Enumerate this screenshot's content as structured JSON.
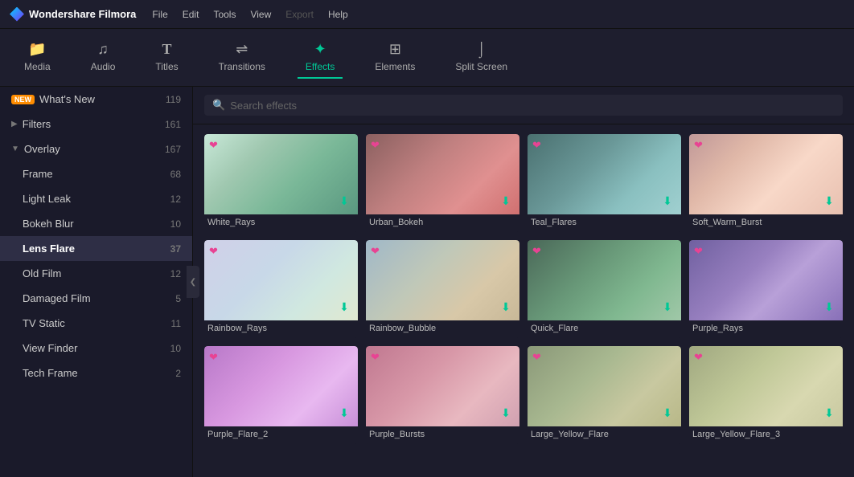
{
  "app": {
    "name": "Wondershare Filmora",
    "logo_alt": "Filmora logo"
  },
  "menu": {
    "items": [
      "File",
      "Edit",
      "Tools",
      "View",
      "Export",
      "Help"
    ],
    "disabled": [
      "Export"
    ]
  },
  "nav_tabs": [
    {
      "id": "media",
      "label": "Media",
      "icon": "🗂"
    },
    {
      "id": "audio",
      "label": "Audio",
      "icon": "🎵"
    },
    {
      "id": "titles",
      "label": "Titles",
      "icon": "T"
    },
    {
      "id": "transitions",
      "label": "Transitions",
      "icon": "↔"
    },
    {
      "id": "effects",
      "label": "Effects",
      "icon": "✦"
    },
    {
      "id": "elements",
      "label": "Elements",
      "icon": "⊞"
    },
    {
      "id": "split_screen",
      "label": "Split Screen",
      "icon": "⊡"
    }
  ],
  "active_tab": "effects",
  "sidebar": {
    "items": [
      {
        "id": "whats-new",
        "label": "What's New",
        "count": "119",
        "badge": "NEW",
        "expanded": false,
        "indent": 0
      },
      {
        "id": "filters",
        "label": "Filters",
        "count": "161",
        "arrow": "▶",
        "expanded": false,
        "indent": 0
      },
      {
        "id": "overlay",
        "label": "Overlay",
        "count": "167",
        "arrow": "▼",
        "expanded": true,
        "indent": 0
      },
      {
        "id": "frame",
        "label": "Frame",
        "count": "68",
        "indent": 1
      },
      {
        "id": "light-leak",
        "label": "Light Leak",
        "count": "12",
        "indent": 1
      },
      {
        "id": "bokeh-blur",
        "label": "Bokeh Blur",
        "count": "10",
        "indent": 1
      },
      {
        "id": "lens-flare",
        "label": "Lens Flare",
        "count": "37",
        "indent": 1,
        "active": true
      },
      {
        "id": "old-film",
        "label": "Old Film",
        "count": "12",
        "indent": 1
      },
      {
        "id": "damaged-film",
        "label": "Damaged Film",
        "count": "5",
        "indent": 1
      },
      {
        "id": "tv-static",
        "label": "TV Static",
        "count": "11",
        "indent": 1
      },
      {
        "id": "view-finder",
        "label": "View Finder",
        "count": "10",
        "indent": 1
      },
      {
        "id": "tech-frame",
        "label": "Tech Frame",
        "count": "2",
        "indent": 1
      }
    ]
  },
  "search": {
    "placeholder": "Search effects"
  },
  "effects_grid": {
    "items": [
      {
        "id": "white-rays",
        "name": "White_Rays",
        "thumb_class": "thumb-white-rays"
      },
      {
        "id": "urban-bokeh",
        "name": "Urban_Bokeh",
        "thumb_class": "thumb-urban-bokeh"
      },
      {
        "id": "teal-flares",
        "name": "Teal_Flares",
        "thumb_class": "thumb-teal-flares"
      },
      {
        "id": "soft-warm-burst",
        "name": "Soft_Warm_Burst",
        "thumb_class": "thumb-soft-warm"
      },
      {
        "id": "rainbow-rays",
        "name": "Rainbow_Rays",
        "thumb_class": "thumb-rainbow-rays"
      },
      {
        "id": "rainbow-bubble",
        "name": "Rainbow_Bubble",
        "thumb_class": "thumb-rainbow-bubble"
      },
      {
        "id": "quick-flare",
        "name": "Quick_Flare",
        "thumb_class": "thumb-quick-flare"
      },
      {
        "id": "purple-rays",
        "name": "Purple_Rays",
        "thumb_class": "thumb-purple-rays"
      },
      {
        "id": "purple-flare-2",
        "name": "Purple_Flare_2",
        "thumb_class": "thumb-purple-flare2"
      },
      {
        "id": "purple-bursts",
        "name": "Purple_Bursts",
        "thumb_class": "thumb-purple-bursts"
      },
      {
        "id": "large-yellow-flare",
        "name": "Large_Yellow_Flare",
        "thumb_class": "thumb-large-yellow"
      },
      {
        "id": "large-yellow-flare-3",
        "name": "Large_Yellow_Flare_3",
        "thumb_class": "thumb-large-yellow3"
      }
    ]
  }
}
